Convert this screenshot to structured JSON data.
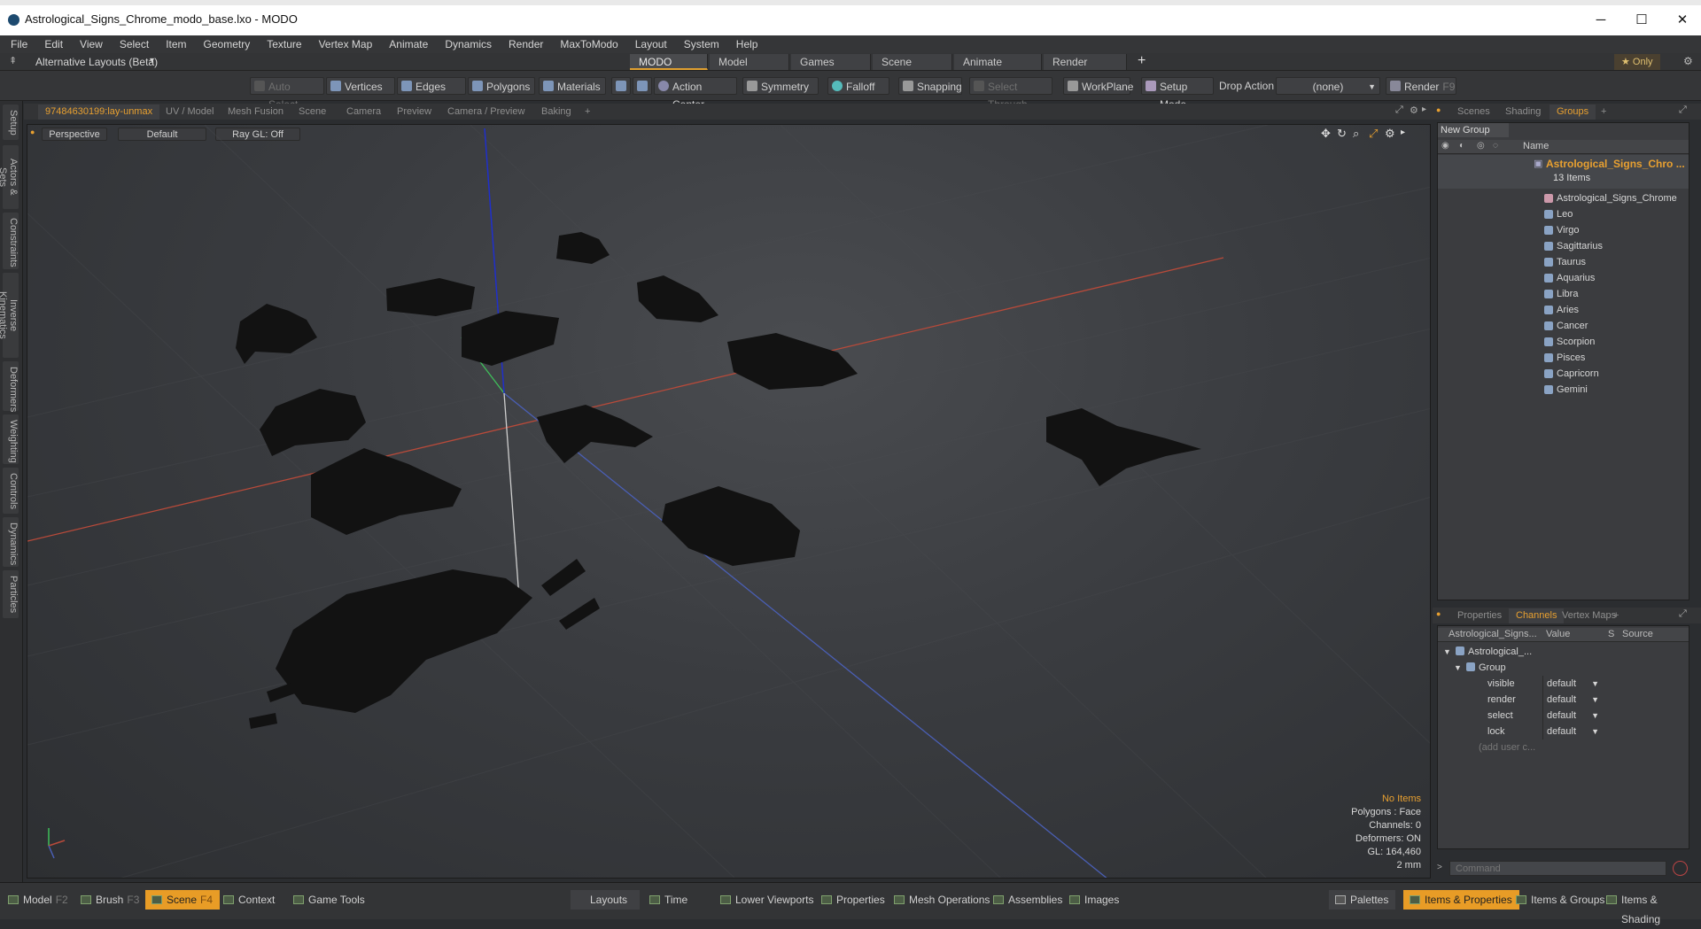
{
  "window": {
    "title": "Astrological_Signs_Chrome_modo_base.lxo - MODO",
    "minimize": "─",
    "maximize": "☐",
    "close": "✕"
  },
  "menu": [
    "File",
    "Edit",
    "View",
    "Select",
    "Item",
    "Geometry",
    "Texture",
    "Vertex Map",
    "Animate",
    "Dynamics",
    "Render",
    "MaxToModo",
    "Layout",
    "System",
    "Help"
  ],
  "layouts": {
    "alt_label": "Alternative Layouts (Beta)",
    "tabs": [
      "MODO Layout",
      "Model Layout",
      "Games Layout",
      "Scene Layout",
      "Animate Layout",
      "Render Layout"
    ],
    "add": "+",
    "only": "★ Only"
  },
  "toolbar": {
    "auto_select": "Auto Select",
    "vertices": "Vertices",
    "edges": "Edges",
    "polygons": "Polygons",
    "materials": "Materials",
    "action_center": "Action Center",
    "symmetry": "Symmetry",
    "falloff": "Falloff",
    "snapping": "Snapping",
    "select_through": "Select Through",
    "workplane": "WorkPlane",
    "setup_mode": "Setup Mode",
    "drop_action": "Drop Action",
    "drop_value": "(none)",
    "render": "Render"
  },
  "left_tabs": [
    "Setup",
    "Actors & Sets",
    "Constraints",
    "Inverse Kinematics",
    "Deformers",
    "Weighting",
    "Controls",
    "Dynamics",
    "Particles"
  ],
  "viewport_tabs": [
    "97484630199:lay-unmax",
    "UV / Model",
    "Mesh Fusion",
    "Scene",
    "Camera",
    "Preview",
    "Camera / Preview",
    "Baking",
    "+"
  ],
  "viewport": {
    "perspective": "Perspective",
    "shading": "Default",
    "raygl": "Ray GL: Off",
    "info": {
      "items": "No Items",
      "polygons": "Polygons : Face",
      "channels": "Channels: 0",
      "deformers": "Deformers: ON",
      "gl": "GL: 164,460",
      "unit": "2 mm"
    }
  },
  "right_tabs": [
    "Scenes",
    "Shading",
    "Groups",
    "+"
  ],
  "groups": {
    "new_group": "New Group",
    "name_header": "Name",
    "root": "Astrological_Signs_Chro ...",
    "count": "13 Items",
    "items": [
      "Astrological_Signs_Chrome",
      "Leo",
      "Virgo",
      "Sagittarius",
      "Taurus",
      "Aquarius",
      "Libra",
      "Aries",
      "Cancer",
      "Scorpion",
      "Pisces",
      "Capricorn",
      "Gemini"
    ]
  },
  "channel_tabs": [
    "Properties",
    "Channels",
    "Vertex Maps",
    "+"
  ],
  "channels": {
    "headers": [
      "Astrological_Signs...",
      "Value",
      "S",
      "Source"
    ],
    "tree": [
      "Astrological_...",
      "Group"
    ],
    "rows": [
      {
        "name": "visible",
        "value": "default"
      },
      {
        "name": "render",
        "value": "default"
      },
      {
        "name": "select",
        "value": "default"
      },
      {
        "name": "lock",
        "value": "default"
      }
    ],
    "add": "(add user c..."
  },
  "command_placeholder": "Command",
  "bottom": {
    "model": "Model",
    "model_key": "F2",
    "brush": "Brush",
    "brush_key": "F3",
    "scene": "Scene",
    "scene_key": "F4",
    "context": "Context",
    "game_tools": "Game Tools",
    "layouts": "Layouts",
    "time": "Time",
    "lower_viewports": "Lower Viewports",
    "properties": "Properties",
    "mesh_operations": "Mesh Operations",
    "assemblies": "Assemblies",
    "images": "Images",
    "palettes": "Palettes",
    "items_properties": "Items & Properties",
    "items_groups": "Items & Groups",
    "items_shading": "Items & Shading"
  },
  "colors": {
    "accent": "#e8a030",
    "x_axis": "#c0392b",
    "y_axis": "#2ecc71",
    "z_axis": "#2233cc"
  }
}
